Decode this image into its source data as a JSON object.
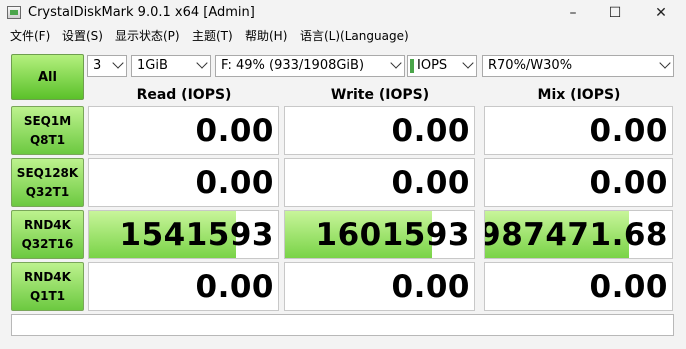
{
  "window": {
    "title": "CrystalDiskMark 9.0.1 x64 [Admin]",
    "min_glyph": "–",
    "max_glyph": "☐",
    "close_glyph": "✕"
  },
  "menu": [
    "文件(F)",
    "设置(S)",
    "显示状态(P)",
    "主题(T)",
    "帮助(H)",
    "语言(L)(Language)"
  ],
  "controls": {
    "all_label": "All",
    "count": "3",
    "size": "1GiB",
    "drive": "F: 49% (933/1908GiB)",
    "unit": "IOPS",
    "mix": "R70%/W30%"
  },
  "columns": {
    "read": "Read (IOPS)",
    "write": "Write (IOPS)",
    "mix": "Mix (IOPS)"
  },
  "rows": [
    {
      "line1": "SEQ1M",
      "line2": "Q8T1",
      "read": "0.00",
      "write": "0.00",
      "mix": "0.00",
      "read_level": 0,
      "write_level": 0,
      "mix_level": 0
    },
    {
      "line1": "SEQ128K",
      "line2": "Q32T1",
      "read": "0.00",
      "write": "0.00",
      "mix": "0.00",
      "read_level": 0,
      "write_level": 0,
      "mix_level": 0
    },
    {
      "line1": "RND4K",
      "line2": "Q32T16",
      "read": "1541593",
      "write": "1601593",
      "mix": "987471.68",
      "read_level": 0.78,
      "write_level": 0.78,
      "mix_level": 0.77
    },
    {
      "line1": "RND4K",
      "line2": "Q1T1",
      "read": "0.00",
      "write": "0.00",
      "mix": "0.00",
      "read_level": 0,
      "write_level": 0,
      "mix_level": 0
    }
  ],
  "status": ""
}
